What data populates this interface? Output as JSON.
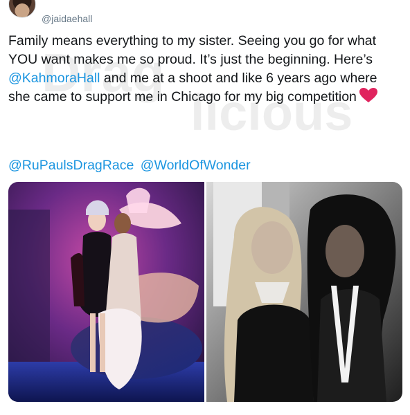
{
  "tweet": {
    "handle": "@jaidaehall",
    "text_before_mention": "Family means everything to my sister. Seeing you go for what YOU want makes me so proud. It’s just the beginning. Here’s ",
    "inline_mention": "@KahmoraHall",
    "text_after_mention": " and me at a shoot and like 6 years ago where she came to support me in Chicago for my big competition",
    "emoji": "heart",
    "tag_mentions": [
      "@RuPaulsDragRace",
      "@WorldOfWonder"
    ]
  },
  "watermark": {
    "text_line1": "Drag",
    "text_line2": "licious"
  },
  "media": {
    "images": [
      {
        "name": "photo-shoot",
        "style": "color"
      },
      {
        "name": "competition-photo",
        "style": "black-and-white"
      }
    ]
  },
  "colors": {
    "link": "#1b95e0",
    "text": "#14171a",
    "secondary": "#657786",
    "heart": "#e0245e"
  }
}
